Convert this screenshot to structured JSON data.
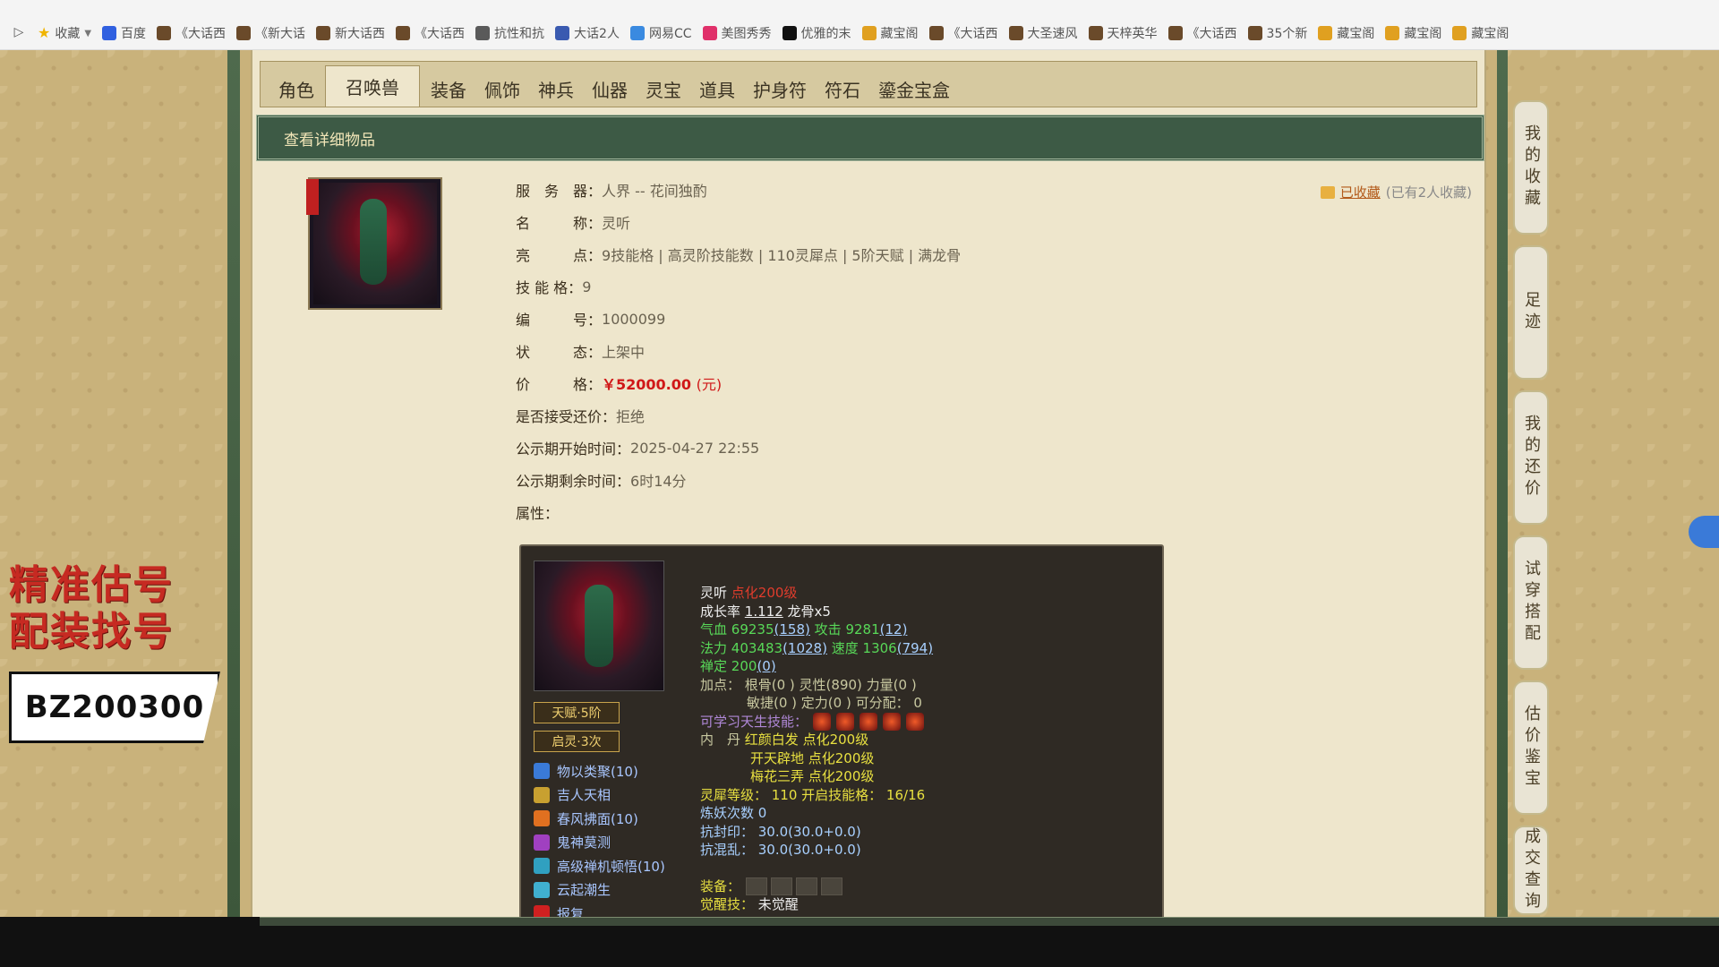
{
  "bookmarks": [
    {
      "label": "收藏",
      "icon": "star-icon",
      "color": "#f0b400"
    },
    {
      "label": "百度",
      "icon": "baidu-paw-icon",
      "color": "#3060e0"
    },
    {
      "label": "《大话西",
      "icon": "game-icon",
      "color": "#6a4a2a"
    },
    {
      "label": "《新大话",
      "icon": "game-icon",
      "color": "#6a4a2a"
    },
    {
      "label": "新大话西",
      "icon": "game-icon",
      "color": "#6a4a2a"
    },
    {
      "label": "《大话西",
      "icon": "game-icon",
      "color": "#6a4a2a"
    },
    {
      "label": "抗性和抗",
      "icon": "game-icon",
      "color": "#5a5a5a"
    },
    {
      "label": "大话2人",
      "icon": "game-icon",
      "color": "#3a5ab0"
    },
    {
      "label": "网易CC",
      "icon": "cc-icon",
      "color": "#3a8ae0"
    },
    {
      "label": "美图秀秀",
      "icon": "meitu-icon",
      "color": "#e0306a"
    },
    {
      "label": "优雅的末",
      "icon": "tiktok-icon",
      "color": "#111111"
    },
    {
      "label": "藏宝阁",
      "icon": "cbg-icon",
      "color": "#e0a020"
    },
    {
      "label": "《大话西",
      "icon": "game-icon",
      "color": "#6a4a2a"
    },
    {
      "label": "大圣速风",
      "icon": "game-icon",
      "color": "#6a4a2a"
    },
    {
      "label": "天梓英华",
      "icon": "game-icon",
      "color": "#6a4a2a"
    },
    {
      "label": "《大话西",
      "icon": "game-icon",
      "color": "#6a4a2a"
    },
    {
      "label": "35个新",
      "icon": "game-icon",
      "color": "#6a4a2a"
    },
    {
      "label": "藏宝阁",
      "icon": "cbg-icon",
      "color": "#e0a020"
    },
    {
      "label": "藏宝阁",
      "icon": "cbg-icon",
      "color": "#e0a020"
    },
    {
      "label": "藏宝阁",
      "icon": "cbg-icon",
      "color": "#e0a020"
    }
  ],
  "promo": {
    "line1": "精准估号",
    "line2": "配装找号",
    "code": "BZ200300"
  },
  "tabs": [
    "角色",
    "召唤兽",
    "装备",
    "佩饰",
    "神兵",
    "仙器",
    "灵宝",
    "道具",
    "护身符",
    "符石",
    "鎏金宝盒"
  ],
  "section_title": "查看详细物品",
  "favorite": {
    "link": "已收藏",
    "count": "(已有2人收藏)"
  },
  "info": {
    "server": {
      "label": "服　务　器：",
      "value": "人界 -- 花间独酌"
    },
    "name": {
      "label": "名　　　称：",
      "value": "灵听"
    },
    "highlights": {
      "label": "亮　　　点：",
      "value": "9技能格 | 高灵阶技能数 | 110灵犀点 | 5阶天赋 | 满龙骨"
    },
    "skill_slots": {
      "label": "技 能 格：",
      "value": "9"
    },
    "id": {
      "label": "编　　　号：",
      "value": "1000099"
    },
    "status": {
      "label": "状　　　态：",
      "value": "上架中"
    },
    "price": {
      "label": "价　　　格：",
      "value": "￥52000.00",
      "unit": "(元)"
    },
    "counter_offer": {
      "label": "是否接受还价：",
      "value": "拒绝"
    },
    "start_time": {
      "label": "公示期开始时间：",
      "value": "2025-04-27 22:55"
    },
    "remaining": {
      "label": "公示期剩余时间：",
      "value": "6时14分"
    },
    "attributes": {
      "label": "属性：",
      "value": ""
    }
  },
  "badges": {
    "talent": "天赋·5阶",
    "awaken": "启灵·3次"
  },
  "skills": [
    {
      "name": "物以类聚(10)",
      "color": "#3a7ad8"
    },
    {
      "name": "吉人天相",
      "color": "#c8a030"
    },
    {
      "name": "春风拂面(10)",
      "color": "#e07020"
    },
    {
      "name": "鬼神莫测",
      "color": "#a040c0"
    },
    {
      "name": "高级禅机顿悟(10)",
      "color": "#30a0c0"
    },
    {
      "name": "云起潮生",
      "color": "#40b0d0"
    },
    {
      "name": "报复",
      "color": "#d02020"
    }
  ],
  "stats": {
    "name": "灵听",
    "level": "点化200级",
    "growth_label": "成长率",
    "growth": "1.112",
    "dragon": "龙骨x5",
    "hp_label": "气血",
    "hp": "69235",
    "hp_bonus": "(158)",
    "atk_label": "攻击",
    "atk": "9281",
    "atk_bonus": "(12)",
    "mp_label": "法力",
    "mp": "403483",
    "mp_bonus": "(1028)",
    "spd_label": "速度",
    "spd": "1306",
    "spd_bonus": "(794)",
    "zen_label": "禅定",
    "zen": "200",
    "zen_bonus": "(0)",
    "points_line1": "加点：  根骨(0 ) 灵性(890) 力量(0 )",
    "points_line2": "敏捷(0 ) 定力(0 ) 可分配：  0",
    "innate_label": "可学习天生技能：",
    "dan_label": "内　丹",
    "dan1": "红颜白发 点化200级",
    "dan2": "开天辟地 点化200级",
    "dan3": "梅花三弄 点化200级",
    "lingxi": "灵犀等级：  110 开启技能格：  16/16",
    "refine": "炼妖次数 0",
    "seal": "抗封印：  30.0(30.0+0.0)",
    "chaos": "抗混乱：  30.0(30.0+0.0)",
    "equip_label": "装备：",
    "awake_label": "觉醒技：",
    "awake_value": "未觉醒"
  },
  "side_tabs": [
    "我的收藏",
    "足迹",
    "我的还价",
    "试穿搭配",
    "估价鉴宝",
    "成交查询"
  ]
}
